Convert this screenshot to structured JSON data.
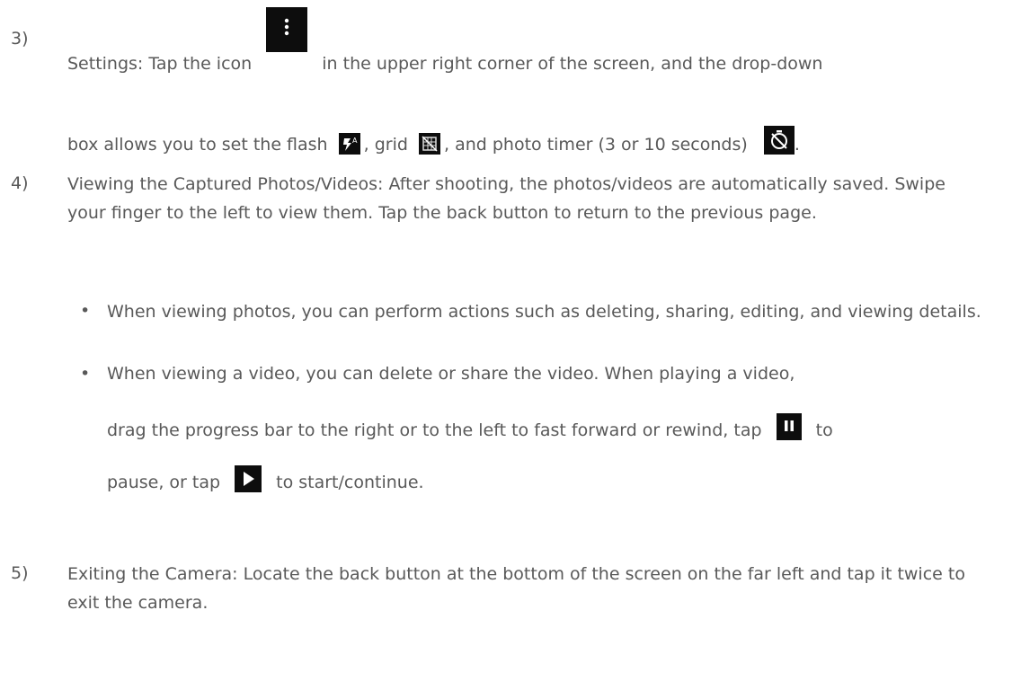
{
  "steps": {
    "s3": {
      "num": "3)",
      "l1a": "Settings: Tap the icon",
      "l1b": "in the upper right corner of the screen, and the drop-down",
      "l2a": "box allows you to set the flash",
      "l2b": ", grid",
      "l2c": ", and photo timer (3 or 10 seconds)",
      "l2d": "."
    },
    "s4": {
      "num": "4)",
      "text": "Viewing the Captured Photos/Videos: After shooting, the photos/videos are automatically saved. Swipe your finger to the left to view them. Tap the back button to return to the previous page."
    },
    "bullets": {
      "b1": "When viewing photos, you can perform actions such as deleting, sharing, editing, and viewing details.",
      "b2l1": "When viewing a video, you can delete or share the video. When playing a video,",
      "b2l2a": "drag the progress bar to the right or to the left to fast forward or rewind, tap",
      "b2l2b": "to",
      "b2l3a": "pause, or tap",
      "b2l3b": "to start/continue.",
      "symbol": "•"
    },
    "s5": {
      "num": "5)",
      "text": "Exiting the Camera: Locate the back button at the bottom of the screen on the far left and tap it twice to exit the camera."
    }
  },
  "icons": [
    "more-vertical-icon",
    "flash-auto-icon",
    "grid-off-icon",
    "timer-off-icon",
    "pause-icon",
    "play-icon"
  ]
}
